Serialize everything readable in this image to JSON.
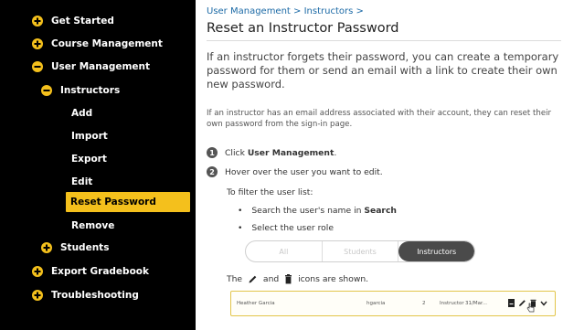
{
  "sidebar": {
    "items": [
      {
        "label": "Get Started",
        "icon": "plus-circle-icon"
      },
      {
        "label": "Course Management",
        "icon": "plus-circle-icon"
      },
      {
        "label": "User Management",
        "icon": "minus-circle-icon"
      },
      {
        "label": "Instructors",
        "icon": "minus-circle-icon"
      },
      {
        "label": "Add"
      },
      {
        "label": "Import"
      },
      {
        "label": "Export"
      },
      {
        "label": "Edit"
      },
      {
        "label": "Reset Password",
        "active": true
      },
      {
        "label": "Remove"
      },
      {
        "label": "Students",
        "icon": "plus-circle-icon"
      },
      {
        "label": "Export Gradebook",
        "icon": "plus-circle-icon"
      },
      {
        "label": "Troubleshooting",
        "icon": "plus-circle-icon"
      }
    ]
  },
  "main": {
    "breadcrumb": "User Management > Instructors >",
    "title": "Reset an Instructor Password",
    "intro": "If an instructor forgets their password, you can create a temporary password for them or send an email with a link to create their own new password.",
    "note": "If an instructor has an email address associated with their account, they can reset their own password from the sign-in page.",
    "steps": [
      {
        "num": "1",
        "prefix": "Click ",
        "bold": "User Management",
        "suffix": "."
      },
      {
        "num": "2",
        "text": "Hover over the user you want to edit."
      }
    ],
    "filter_label": "To filter the user list:",
    "bullets": [
      {
        "prefix": "Search the user's name in ",
        "bold": "Search"
      },
      {
        "text": "Select the user role"
      }
    ],
    "segmented": {
      "options": [
        "All",
        "Students",
        "Instructors"
      ],
      "selected": "Instructors"
    },
    "icons_line": {
      "prefix": "The ",
      "middle": " and ",
      "suffix": " icons are shown."
    },
    "user_row": {
      "name": "Heather Garcia",
      "username": "hgarcia",
      "count": "2",
      "role": "Instructor",
      "date": "31/Mar..."
    }
  },
  "colors": {
    "sidebar_bg": "#000000",
    "accent": "#f4c01c",
    "link": "#1c6aa6",
    "segment_active": "#4a4a4a"
  }
}
